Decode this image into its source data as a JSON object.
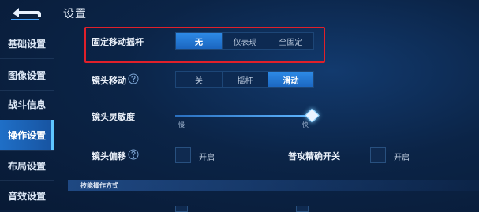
{
  "header": {
    "title": "设置"
  },
  "sidebar": {
    "items": [
      {
        "label": "基础设置",
        "active": false
      },
      {
        "label": "图像设置",
        "active": false
      },
      {
        "label": "战斗信息",
        "active": false
      },
      {
        "label": "操作设置",
        "active": true
      },
      {
        "label": "布局设置",
        "active": false
      },
      {
        "label": "音效设置",
        "active": false
      }
    ]
  },
  "settings": {
    "joystick": {
      "label": "固定移动摇杆",
      "options": [
        "无",
        "仅表现",
        "全固定"
      ],
      "selected": "无"
    },
    "camera_move": {
      "label": "镜头移动",
      "options": [
        "关",
        "摇杆",
        "滑动"
      ],
      "selected": "滑动"
    },
    "sensitivity": {
      "label": "镜头灵敏度",
      "min_label": "慢",
      "max_label": "快",
      "value": 1.0
    },
    "camera_offset": {
      "label": "镜头偏移",
      "toggle_label": "开启"
    },
    "precise_attack": {
      "label": "普攻精确开关",
      "toggle_label": "开启"
    },
    "skill_section": {
      "label": "技能操作方式"
    }
  },
  "colors": {
    "accent": "#1f6fc7",
    "highlight": "#e0202a",
    "background": "#0a1f3d"
  },
  "icons": [
    "back-arrow-icon",
    "help-icon"
  ]
}
